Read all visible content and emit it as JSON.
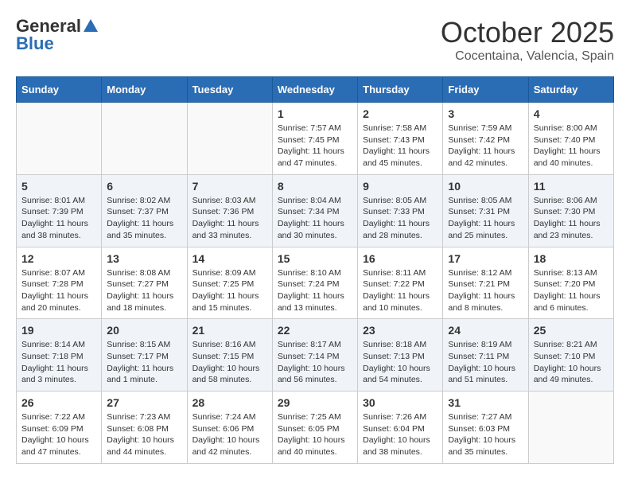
{
  "header": {
    "logo_general": "General",
    "logo_blue": "Blue",
    "month_title": "October 2025",
    "subtitle": "Cocentaina, Valencia, Spain"
  },
  "weekdays": [
    "Sunday",
    "Monday",
    "Tuesday",
    "Wednesday",
    "Thursday",
    "Friday",
    "Saturday"
  ],
  "weeks": [
    [
      {
        "day": "",
        "sunrise": "",
        "sunset": "",
        "daylight": ""
      },
      {
        "day": "",
        "sunrise": "",
        "sunset": "",
        "daylight": ""
      },
      {
        "day": "",
        "sunrise": "",
        "sunset": "",
        "daylight": ""
      },
      {
        "day": "1",
        "sunrise": "7:57 AM",
        "sunset": "7:45 PM",
        "daylight": "11 hours and 47 minutes."
      },
      {
        "day": "2",
        "sunrise": "7:58 AM",
        "sunset": "7:43 PM",
        "daylight": "11 hours and 45 minutes."
      },
      {
        "day": "3",
        "sunrise": "7:59 AM",
        "sunset": "7:42 PM",
        "daylight": "11 hours and 42 minutes."
      },
      {
        "day": "4",
        "sunrise": "8:00 AM",
        "sunset": "7:40 PM",
        "daylight": "11 hours and 40 minutes."
      }
    ],
    [
      {
        "day": "5",
        "sunrise": "8:01 AM",
        "sunset": "7:39 PM",
        "daylight": "11 hours and 38 minutes."
      },
      {
        "day": "6",
        "sunrise": "8:02 AM",
        "sunset": "7:37 PM",
        "daylight": "11 hours and 35 minutes."
      },
      {
        "day": "7",
        "sunrise": "8:03 AM",
        "sunset": "7:36 PM",
        "daylight": "11 hours and 33 minutes."
      },
      {
        "day": "8",
        "sunrise": "8:04 AM",
        "sunset": "7:34 PM",
        "daylight": "11 hours and 30 minutes."
      },
      {
        "day": "9",
        "sunrise": "8:05 AM",
        "sunset": "7:33 PM",
        "daylight": "11 hours and 28 minutes."
      },
      {
        "day": "10",
        "sunrise": "8:05 AM",
        "sunset": "7:31 PM",
        "daylight": "11 hours and 25 minutes."
      },
      {
        "day": "11",
        "sunrise": "8:06 AM",
        "sunset": "7:30 PM",
        "daylight": "11 hours and 23 minutes."
      }
    ],
    [
      {
        "day": "12",
        "sunrise": "8:07 AM",
        "sunset": "7:28 PM",
        "daylight": "11 hours and 20 minutes."
      },
      {
        "day": "13",
        "sunrise": "8:08 AM",
        "sunset": "7:27 PM",
        "daylight": "11 hours and 18 minutes."
      },
      {
        "day": "14",
        "sunrise": "8:09 AM",
        "sunset": "7:25 PM",
        "daylight": "11 hours and 15 minutes."
      },
      {
        "day": "15",
        "sunrise": "8:10 AM",
        "sunset": "7:24 PM",
        "daylight": "11 hours and 13 minutes."
      },
      {
        "day": "16",
        "sunrise": "8:11 AM",
        "sunset": "7:22 PM",
        "daylight": "11 hours and 10 minutes."
      },
      {
        "day": "17",
        "sunrise": "8:12 AM",
        "sunset": "7:21 PM",
        "daylight": "11 hours and 8 minutes."
      },
      {
        "day": "18",
        "sunrise": "8:13 AM",
        "sunset": "7:20 PM",
        "daylight": "11 hours and 6 minutes."
      }
    ],
    [
      {
        "day": "19",
        "sunrise": "8:14 AM",
        "sunset": "7:18 PM",
        "daylight": "11 hours and 3 minutes."
      },
      {
        "day": "20",
        "sunrise": "8:15 AM",
        "sunset": "7:17 PM",
        "daylight": "11 hours and 1 minute."
      },
      {
        "day": "21",
        "sunrise": "8:16 AM",
        "sunset": "7:15 PM",
        "daylight": "10 hours and 58 minutes."
      },
      {
        "day": "22",
        "sunrise": "8:17 AM",
        "sunset": "7:14 PM",
        "daylight": "10 hours and 56 minutes."
      },
      {
        "day": "23",
        "sunrise": "8:18 AM",
        "sunset": "7:13 PM",
        "daylight": "10 hours and 54 minutes."
      },
      {
        "day": "24",
        "sunrise": "8:19 AM",
        "sunset": "7:11 PM",
        "daylight": "10 hours and 51 minutes."
      },
      {
        "day": "25",
        "sunrise": "8:21 AM",
        "sunset": "7:10 PM",
        "daylight": "10 hours and 49 minutes."
      }
    ],
    [
      {
        "day": "26",
        "sunrise": "7:22 AM",
        "sunset": "6:09 PM",
        "daylight": "10 hours and 47 minutes."
      },
      {
        "day": "27",
        "sunrise": "7:23 AM",
        "sunset": "6:08 PM",
        "daylight": "10 hours and 44 minutes."
      },
      {
        "day": "28",
        "sunrise": "7:24 AM",
        "sunset": "6:06 PM",
        "daylight": "10 hours and 42 minutes."
      },
      {
        "day": "29",
        "sunrise": "7:25 AM",
        "sunset": "6:05 PM",
        "daylight": "10 hours and 40 minutes."
      },
      {
        "day": "30",
        "sunrise": "7:26 AM",
        "sunset": "6:04 PM",
        "daylight": "10 hours and 38 minutes."
      },
      {
        "day": "31",
        "sunrise": "7:27 AM",
        "sunset": "6:03 PM",
        "daylight": "10 hours and 35 minutes."
      },
      {
        "day": "",
        "sunrise": "",
        "sunset": "",
        "daylight": ""
      }
    ]
  ]
}
